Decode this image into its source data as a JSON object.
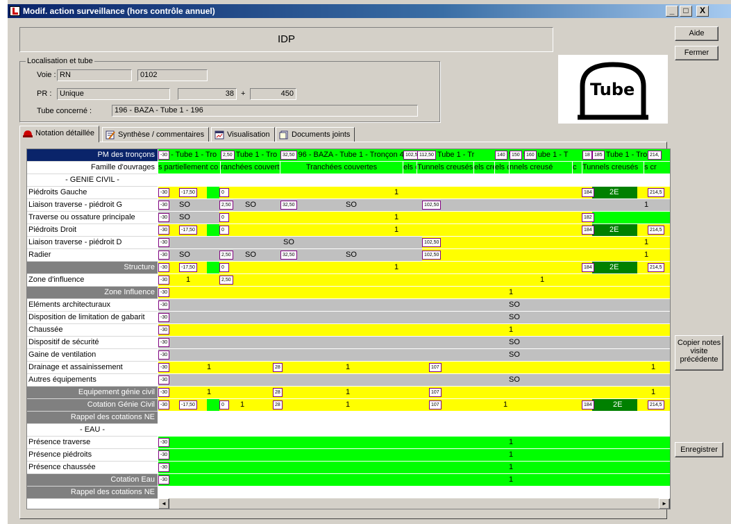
{
  "window": {
    "title": "Modif. action surveillance (hors contrôle annuel)",
    "min": "_",
    "max": "□",
    "close": "X"
  },
  "header": {
    "code": "IDP"
  },
  "buttons": {
    "aide": "Aide",
    "fermer": "Fermer",
    "copier": "Copier notes visite précédente",
    "enregistrer": "Enregistrer"
  },
  "loc": {
    "legend": "Localisation et tube",
    "voie_label": "Voie :",
    "voie_type": "RN",
    "voie_num": "0102",
    "pr_label": "PR :",
    "pr_mode": "Unique",
    "pr_val": "38",
    "plus": "+",
    "pr_offset": "450",
    "tube_label": "Tube concerné :",
    "tube": "196 - BAZA - Tube 1 - 196"
  },
  "logo": {
    "text": "Tube"
  },
  "tabs": [
    "Notation détaillée",
    "Synthèse / commentaires",
    "Visualisation",
    "Documents joints"
  ],
  "grid": {
    "troncons_label": "PM des tronçons",
    "troncons": [
      {
        "mk": "-30",
        "text": "- Tube 1 - Tro"
      },
      {
        "mk": "2,50",
        "text": "Tube 1 - Tro"
      },
      {
        "mk": "32,50",
        "text": "96 - BAZA - Tube 1 - Tronçon 4"
      },
      {
        "mk": "102,50",
        "text": ""
      },
      {
        "mk": "112,50",
        "text": "Tube 1 - Tr"
      },
      {
        "mk": "140",
        "text": "5"
      },
      {
        "mk": "150",
        "text": "5"
      },
      {
        "mk": "160",
        "text": "ube 1 - T"
      },
      {
        "mk": "18",
        "text": ""
      },
      {
        "mk": "185",
        "text": "Tube 1 - Tro"
      },
      {
        "mk": "214,",
        "text": ""
      }
    ],
    "famille_label": "Famille d'ouvrages",
    "familles": [
      "s partiellement co",
      "ranchées couverte",
      "Tranchées couvertes",
      "els cre",
      "Tunnels creusés",
      "els cre",
      "els cre",
      "nnels creusé",
      "c",
      "Tunnels creusés",
      "s cr"
    ],
    "rows": [
      {
        "label": "- GENIE CIVIL -",
        "type": "section",
        "marks": [],
        "values": []
      },
      {
        "label": "Piédroits Gauche",
        "type": "normal",
        "marks": [
          "-30",
          "-17,50",
          "0",
          "184",
          "214,5"
        ],
        "values": [
          "1",
          "2E"
        ]
      },
      {
        "label": "Liaison traverse - piédroit G",
        "type": "normal",
        "marks": [
          "-30",
          "2,50",
          "32,50",
          "102,50"
        ],
        "values": [
          "SO",
          "SO",
          "SO",
          "1"
        ]
      },
      {
        "label": "Traverse ou ossature principale",
        "type": "normal",
        "marks": [
          "-30",
          "0",
          "182"
        ],
        "values": [
          "SO",
          "1"
        ]
      },
      {
        "label": "Piédroits Droit",
        "type": "normal",
        "marks": [
          "-30",
          "-17,50",
          "0",
          "184",
          "214,5"
        ],
        "values": [
          "1",
          "2E"
        ]
      },
      {
        "label": "Liaison traverse - piédroit D",
        "type": "normal",
        "marks": [
          "-30",
          "102,50"
        ],
        "values": [
          "SO",
          "1"
        ]
      },
      {
        "label": "Radier",
        "type": "normal",
        "marks": [
          "-30",
          "2,50",
          "32,50",
          "102,50"
        ],
        "values": [
          "SO",
          "SO",
          "SO",
          "1"
        ]
      },
      {
        "label": "Structure",
        "type": "total",
        "marks": [
          "-30",
          "-17,50",
          "0",
          "184",
          "214,5"
        ],
        "values": [
          "1",
          "2E"
        ]
      },
      {
        "label": "Zone d'influence",
        "type": "normal",
        "marks": [
          "-30",
          "2,50"
        ],
        "values": [
          "1",
          "1"
        ]
      },
      {
        "label": "Zone Influence",
        "type": "total",
        "marks": [
          "-30"
        ],
        "values": [
          "1"
        ]
      },
      {
        "label": "Eléments architecturaux",
        "type": "normal",
        "marks": [
          "-30"
        ],
        "values": [
          "SO"
        ]
      },
      {
        "label": "Disposition de limitation de gabarit",
        "type": "normal",
        "marks": [
          "-30"
        ],
        "values": [
          "SO"
        ]
      },
      {
        "label": "Chaussée",
        "type": "normal",
        "marks": [
          "-30"
        ],
        "values": [
          "1"
        ]
      },
      {
        "label": "Dispositif de sécurité",
        "type": "normal",
        "marks": [
          "-30"
        ],
        "values": [
          "SO"
        ]
      },
      {
        "label": "Gaine de ventilation",
        "type": "normal",
        "marks": [
          "-30"
        ],
        "values": [
          "SO"
        ]
      },
      {
        "label": "Drainage et assainissement",
        "type": "normal",
        "marks": [
          "-30",
          "28",
          "107"
        ],
        "values": [
          "1",
          "1",
          "1"
        ]
      },
      {
        "label": "Autres équipements",
        "type": "normal",
        "marks": [
          "-30"
        ],
        "values": [
          "SO"
        ]
      },
      {
        "label": "Equipement génie civil",
        "type": "total",
        "marks": [
          "-30",
          "28",
          "107"
        ],
        "values": [
          "1",
          "1",
          "1"
        ]
      },
      {
        "label": "Cotation Génie Civil",
        "type": "total",
        "marks": [
          "-30",
          "-17,50",
          "0",
          "28",
          "107",
          "184",
          "214,5"
        ],
        "values": [
          "1",
          "1",
          "1",
          "2E"
        ]
      },
      {
        "label": "Rappel des cotations NE",
        "type": "total",
        "marks": [],
        "values": []
      },
      {
        "label": "- EAU -",
        "type": "section",
        "marks": [],
        "values": []
      },
      {
        "label": "Présence traverse",
        "type": "normal",
        "marks": [
          "-30"
        ],
        "values": [
          "1"
        ]
      },
      {
        "label": "Présence piédroits",
        "type": "normal",
        "marks": [
          "-30"
        ],
        "values": [
          "1"
        ]
      },
      {
        "label": "Présence chaussée",
        "type": "normal",
        "marks": [
          "-30"
        ],
        "values": [
          "1"
        ]
      },
      {
        "label": "Cotation Eau",
        "type": "total",
        "marks": [
          "-30"
        ],
        "values": [
          "1"
        ]
      },
      {
        "label": "Rappel des cotations NE",
        "type": "total",
        "marks": [],
        "values": []
      }
    ],
    "scroll_left": "◄",
    "scroll_right": "►"
  },
  "colors": {
    "yellow": "#ffff00",
    "green": "#00ff00",
    "darkgreen": "#008000",
    "gray": "#c0c0c0",
    "header_blue": "#0a246a",
    "total_gray": "#808080"
  }
}
